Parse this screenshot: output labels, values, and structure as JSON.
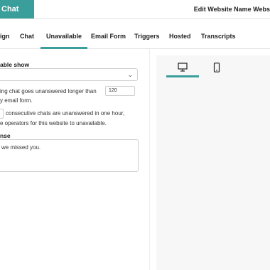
{
  "header": {
    "brand": "Chat",
    "title": "Edit Website Name Webs"
  },
  "tabs": [
    {
      "label": "ign"
    },
    {
      "label": "Chat"
    },
    {
      "label": "Unavailable",
      "active": true
    },
    {
      "label": "Email Form"
    },
    {
      "label": "Triggers"
    },
    {
      "label": "Hosted"
    },
    {
      "label": "Transcripts"
    }
  ],
  "form": {
    "show_label": "able show",
    "select_value": "",
    "line1_text": "ing chat goes unanswered longer than",
    "seconds_value": "120",
    "line2_text": "y email form.",
    "line3_text": "consecutive chats are unanswered in one hour,",
    "line4_text": "e operators for this website to unavailable.",
    "response_label": "nse",
    "response_value": "we missed you."
  },
  "preview": {
    "tabs": [
      {
        "icon": "desktop-icon",
        "active": true
      },
      {
        "icon": "mobile-icon",
        "active": false
      }
    ]
  },
  "colors": {
    "accent": "#3a9e9b",
    "preview_bg": "#f7f7f7"
  }
}
